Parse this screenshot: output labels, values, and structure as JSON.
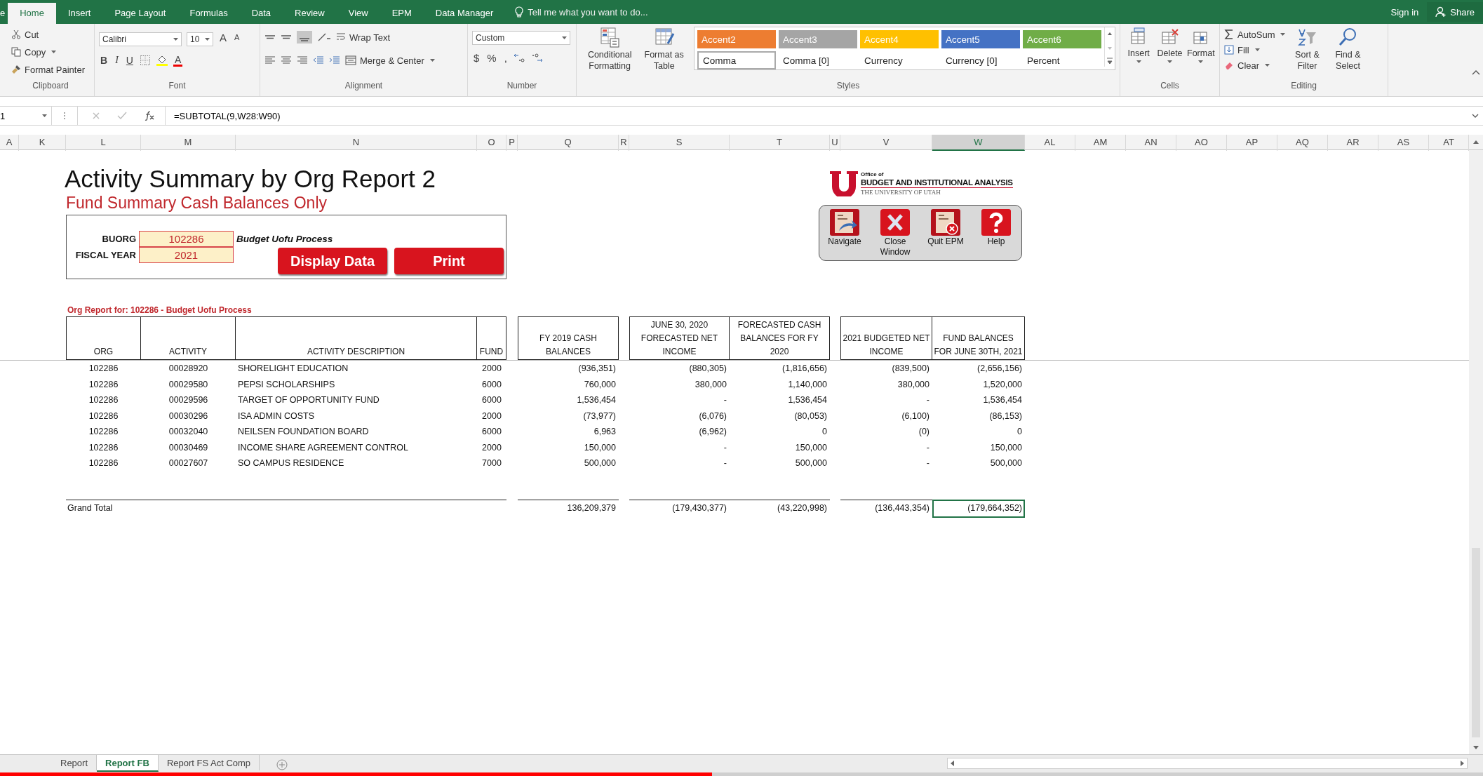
{
  "ribbon_tabs": [
    {
      "label": "e",
      "selected": false
    },
    {
      "label": "Home",
      "selected": true
    },
    {
      "label": "Insert",
      "selected": false
    },
    {
      "label": "Page Layout",
      "selected": false
    },
    {
      "label": "Formulas",
      "selected": false
    },
    {
      "label": "Data",
      "selected": false
    },
    {
      "label": "Review",
      "selected": false
    },
    {
      "label": "View",
      "selected": false
    },
    {
      "label": "EPM",
      "selected": false
    },
    {
      "label": "Data Manager",
      "selected": false
    }
  ],
  "tell_me": "Tell me what you want to do...",
  "account": {
    "sign_in": "Sign in",
    "share": "Share"
  },
  "ribbon": {
    "clipboard": {
      "label": "Clipboard",
      "cut": "Cut",
      "copy": "Copy",
      "format_painter": "Format Painter"
    },
    "font": {
      "label": "Font",
      "font_name": "Calibri",
      "font_size": "10",
      "grow": "A",
      "shrink": "A",
      "bold": "B",
      "italic": "I",
      "underline": "U",
      "color_button": "A"
    },
    "alignment": {
      "label": "Alignment",
      "wrap_text": "Wrap Text",
      "merge_center": "Merge & Center"
    },
    "number": {
      "label": "Number",
      "format": "Custom",
      "currency": "$",
      "percent": "%",
      "comma": ","
    },
    "styles": {
      "label": "Styles",
      "conditional_formatting": "Conditional Formatting",
      "format_as_table": "Format as Table",
      "accent_styles": [
        {
          "label": "Accent2",
          "color": "#ed7d31"
        },
        {
          "label": "Accent3",
          "color": "#a5a5a5"
        },
        {
          "label": "Accent4",
          "color": "#ffc000"
        },
        {
          "label": "Accent5",
          "color": "#4472c4"
        },
        {
          "label": "Accent6",
          "color": "#70ad47"
        }
      ],
      "number_styles": [
        {
          "label": "Comma",
          "selected": true
        },
        {
          "label": "Comma [0]",
          "selected": false
        },
        {
          "label": "Currency",
          "selected": false
        },
        {
          "label": "Currency [0]",
          "selected": false
        },
        {
          "label": "Percent",
          "selected": false
        }
      ]
    },
    "cells": {
      "label": "Cells",
      "buttons": [
        "Insert",
        "Delete",
        "Format"
      ]
    },
    "editing": {
      "label": "Editing",
      "autosum": "AutoSum",
      "fill": "Fill",
      "clear": "Clear",
      "sort_filter": "Sort & Filter",
      "find_select": "Find & Select"
    }
  },
  "formula_bar": {
    "name_box": "1",
    "formula": "=SUBTOTAL(9,W28:W90)"
  },
  "columns": [
    {
      "label": "A",
      "selected": false
    },
    {
      "label": "K",
      "selected": false
    },
    {
      "label": "L",
      "selected": false
    },
    {
      "label": "M",
      "selected": false
    },
    {
      "label": "N",
      "selected": false
    },
    {
      "label": "O",
      "selected": false
    },
    {
      "label": "P",
      "selected": false
    },
    {
      "label": "Q",
      "selected": false
    },
    {
      "label": "R",
      "selected": false
    },
    {
      "label": "S",
      "selected": false
    },
    {
      "label": "T",
      "selected": false
    },
    {
      "label": "U",
      "selected": false
    },
    {
      "label": "V",
      "selected": false
    },
    {
      "label": "W",
      "selected": true
    },
    {
      "label": "AL",
      "selected": false
    },
    {
      "label": "AM",
      "selected": false
    },
    {
      "label": "AN",
      "selected": false
    },
    {
      "label": "AO",
      "selected": false
    },
    {
      "label": "AP",
      "selected": false
    },
    {
      "label": "AQ",
      "selected": false
    },
    {
      "label": "AR",
      "selected": false
    },
    {
      "label": "AS",
      "selected": false
    },
    {
      "label": "AT",
      "selected": false
    }
  ],
  "report": {
    "title": "Activity Summary by Org Report 2",
    "subtitle": "Fund Summary Cash Balances Only",
    "params": [
      {
        "label": "BUORG",
        "value": "102286"
      },
      {
        "label": "FISCAL YEAR",
        "value": "2021"
      }
    ],
    "org_name": "Budget Uofu Process",
    "buttons": [
      "Display Data",
      "Print"
    ]
  },
  "logo": {
    "office": "Office of",
    "unit": "BUDGET AND INSTITUTIONAL ANALYSIS",
    "university": "THE UNIVERSITY OF UTAH"
  },
  "macro_buttons": [
    {
      "label": "Navigate",
      "kind": "navigate"
    },
    {
      "label": "Close Window",
      "kind": "close"
    },
    {
      "label": "Quit EPM",
      "kind": "quit"
    },
    {
      "label": "Help",
      "kind": "help"
    }
  ],
  "table": {
    "caption": "Org Report for: 102286 - Budget Uofu Process",
    "columns": [
      "ORG",
      "ACTIVITY",
      "ACTIVITY DESCRIPTION",
      "FUND",
      "FY 2019 CASH BALANCES",
      "JUNE 30, 2020 FORECASTED NET INCOME",
      "FORECASTED CASH BALANCES FOR FY 2020",
      "2021 BUDGETED NET INCOME",
      "FUND BALANCES FOR JUNE 30TH, 2021"
    ],
    "rows": [
      [
        "102286",
        "00028920",
        "SHORELIGHT EDUCATION",
        "2000",
        "(936,351)",
        "(880,305)",
        "(1,816,656)",
        "(839,500)",
        "(2,656,156)"
      ],
      [
        "102286",
        "00029580",
        "PEPSI SCHOLARSHIPS",
        "6000",
        "760,000",
        "380,000",
        "1,140,000",
        "380,000",
        "1,520,000"
      ],
      [
        "102286",
        "00029596",
        "TARGET OF OPPORTUNITY FUND",
        "6000",
        "1,536,454",
        "-",
        "1,536,454",
        "-",
        "1,536,454"
      ],
      [
        "102286",
        "00030296",
        "ISA ADMIN COSTS",
        "2000",
        "(73,977)",
        "(6,076)",
        "(80,053)",
        "(6,100)",
        "(86,153)"
      ],
      [
        "102286",
        "00032040",
        "NEILSEN FOUNDATION BOARD",
        "6000",
        "6,963",
        "(6,962)",
        "0",
        "(0)",
        "0"
      ],
      [
        "102286",
        "00030469",
        "INCOME SHARE AGREEMENT CONTROL",
        "2000",
        "150,000",
        "-",
        "150,000",
        "-",
        "150,000"
      ],
      [
        "102286",
        "00027607",
        "SO CAMPUS RESIDENCE",
        "7000",
        "500,000",
        "-",
        "500,000",
        "-",
        "500,000"
      ]
    ],
    "total_label": "Grand Total",
    "totals": [
      {
        "value": "136,209,379",
        "selected": false
      },
      {
        "value": "(179,430,377)",
        "selected": false
      },
      {
        "value": "(43,220,998)",
        "selected": false
      },
      {
        "value": "(136,443,354)",
        "selected": false
      },
      {
        "value": "(179,664,352)",
        "selected": true
      }
    ]
  },
  "sheet_tabs": [
    {
      "label": "Report",
      "selected": false
    },
    {
      "label": "Report FB",
      "selected": true
    },
    {
      "label": "Report FS Act Comp",
      "selected": false
    }
  ],
  "video_progress": {
    "level": 0.48
  }
}
